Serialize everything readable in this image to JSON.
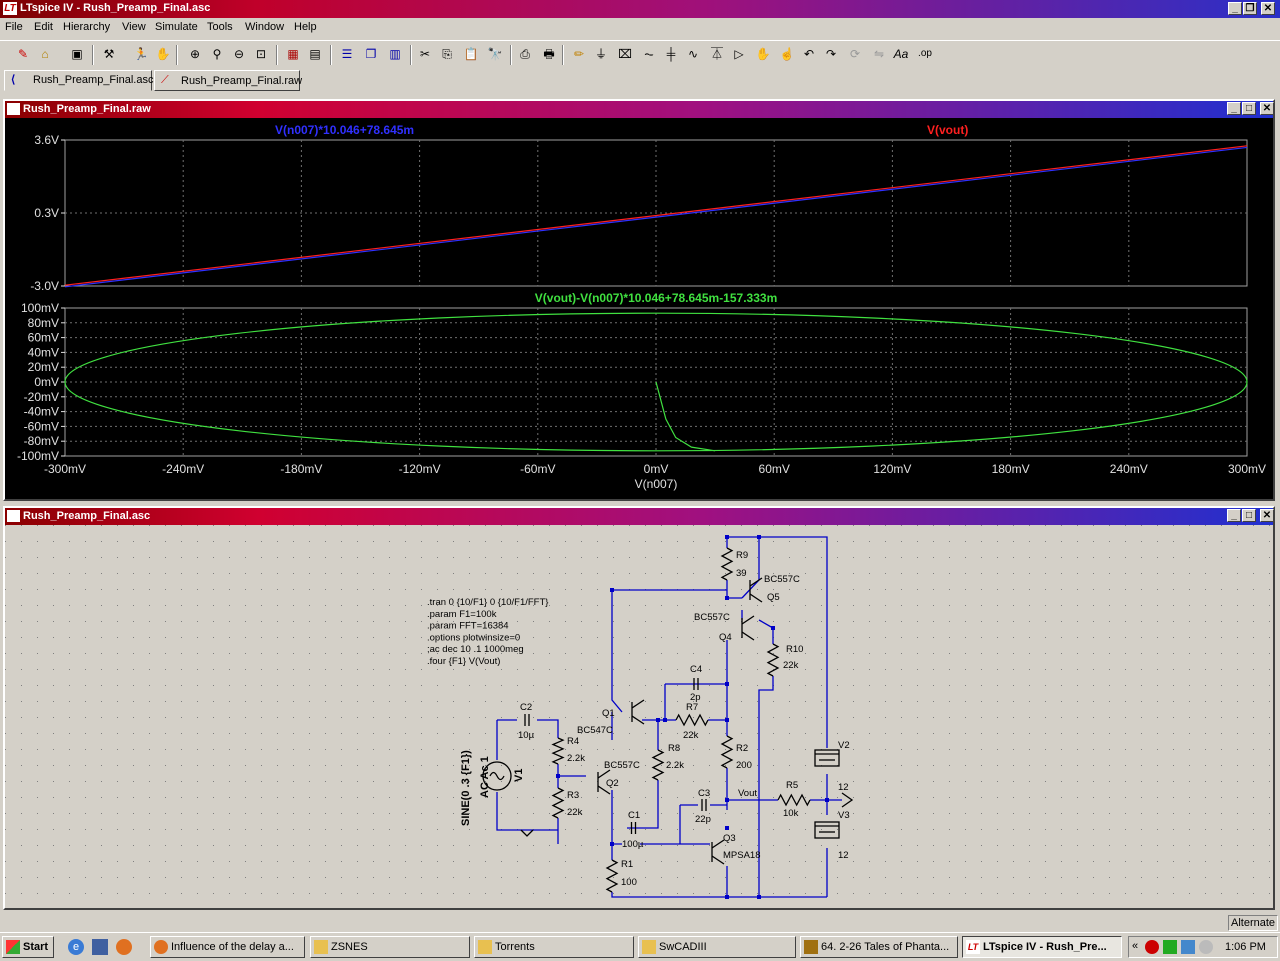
{
  "app": {
    "title": "LTspice IV - Rush_Preamp_Final.asc",
    "icon": "ltspice-icon"
  },
  "menu": [
    "File",
    "Edit",
    "Hierarchy",
    "View",
    "Simulate",
    "Tools",
    "Window",
    "Help"
  ],
  "toolbar": [
    "new-schematic-icon",
    "open-icon",
    "save-icon",
    "control-panel-icon",
    "run-icon",
    "halt-icon",
    "zoom-in-icon",
    "zoom-pan-icon",
    "zoom-out-icon",
    "zoom-fit-icon",
    "autorange-icon",
    "plot-settings-icon",
    "tile-horizontal-icon",
    "cascade-icon",
    "tile-icon",
    "cut-icon",
    "copy-icon",
    "paste-icon",
    "find-icon",
    "print-setup-icon",
    "print-icon",
    "draw-wire-icon",
    "ground-icon",
    "label-net-icon",
    "resistor-icon",
    "capacitor-icon",
    "inductor-icon",
    "diode-icon",
    "component-icon",
    "move-icon",
    "drag-icon",
    "undo-icon",
    "redo-icon",
    "rotate-icon",
    "mirror-icon",
    "text-icon",
    "spice-directive-icon"
  ],
  "tabs": [
    {
      "label": "Rush_Preamp_Final.asc",
      "icon": "schematic-icon"
    },
    {
      "label": "Rush_Preamp_Final.raw",
      "icon": "waveform-icon"
    }
  ],
  "waveform_window": {
    "title": "Rush_Preamp_Final.raw"
  },
  "schematic_window": {
    "title": "Rush_Preamp_Final.asc"
  },
  "chart_data": [
    {
      "type": "line",
      "series": [
        {
          "name": "V(n007)*10.046+78.645m",
          "color": "#3030ff",
          "x": [
            -300,
            300
          ],
          "y": [
            -3.0,
            3.3
          ]
        },
        {
          "name": "V(vout)",
          "color": "#ff2020",
          "x": [
            -300,
            300
          ],
          "y": [
            -3.0,
            3.3
          ]
        }
      ],
      "ytick_labels": [
        "3.6V",
        "0.3V",
        "-3.0V"
      ],
      "ylim": [
        -3.0,
        3.6
      ],
      "xlim": [
        -300,
        300
      ],
      "grid": true
    },
    {
      "type": "line",
      "series": [
        {
          "name": "V(vout)-V(n007)*10.046+78.645m-157.333m",
          "color": "#40e040"
        }
      ],
      "ytick_labels": [
        "100mV",
        "80mV",
        "60mV",
        "40mV",
        "20mV",
        "0mV",
        "-20mV",
        "-40mV",
        "-60mV",
        "-80mV",
        "-100mV"
      ],
      "xtick_labels": [
        "-300mV",
        "-240mV",
        "-180mV",
        "-120mV",
        "-60mV",
        "0mV",
        "60mV",
        "120mV",
        "180mV",
        "240mV",
        "300mV"
      ],
      "xlabel": "V(n007)",
      "ylim": [
        -100,
        100
      ],
      "xlim": [
        -300,
        300
      ],
      "ellipse": {
        "center_x": 0,
        "center_y": 0,
        "radius_x": 300,
        "radius_y": 93
      },
      "start_trace": {
        "x": [
          0,
          2,
          5,
          10,
          18,
          30
        ],
        "y": [
          0,
          -20,
          -50,
          -75,
          -88,
          -93
        ]
      },
      "grid": true
    }
  ],
  "schematic": {
    "directives": [
      ".tran 0 {10/F1} 0 {10/F1/FFT}",
      ".param F1=100k",
      ".param FFT=16384",
      ".options plotwinsize=0",
      ";ac dec 10 .1 1000meg",
      ".four {F1} V(Vout)"
    ],
    "components": [
      {
        "ref": "R9",
        "value": "39"
      },
      {
        "ref": "Q5",
        "value": "BC557C"
      },
      {
        "ref": "Q4",
        "value": "BC557C"
      },
      {
        "ref": "R10",
        "value": "22k"
      },
      {
        "ref": "C4",
        "value": "2p"
      },
      {
        "ref": "Q1",
        "value": "BC547C"
      },
      {
        "ref": "R7",
        "value": "22k"
      },
      {
        "ref": "R8",
        "value": "2.2k"
      },
      {
        "ref": "C2",
        "value": "10µ"
      },
      {
        "ref": "R4",
        "value": "2.2k"
      },
      {
        "ref": "Q2",
        "value": "BC557C"
      },
      {
        "ref": "R2",
        "value": "200"
      },
      {
        "ref": "V2",
        "value": "12"
      },
      {
        "ref": "R5",
        "value": "10k"
      },
      {
        "ref": "V3",
        "value": "12"
      },
      {
        "ref": "C3",
        "value": "22p"
      },
      {
        "ref": "R3",
        "value": "22k"
      },
      {
        "ref": "C1",
        "value": "100µ"
      },
      {
        "ref": "Q3",
        "value": "MPSA18"
      },
      {
        "ref": "R1",
        "value": "100"
      },
      {
        "ref": "V1",
        "value": "SINE(0 .3 {F1})",
        "extra": "AC Ac 1"
      }
    ],
    "net_label": "Vout"
  },
  "status": {
    "text": "Alternate"
  },
  "taskbar": {
    "start": "Start",
    "items": [
      {
        "label": "Influence of the delay a...",
        "icon": "firefox-icon"
      },
      {
        "label": "ZSNES",
        "icon": "folder-icon"
      },
      {
        "label": "Torrents",
        "icon": "folder-icon"
      },
      {
        "label": "SwCADIII",
        "icon": "folder-icon"
      },
      {
        "label": "64. 2-26 Tales of Phanta...",
        "icon": "winamp-icon"
      },
      {
        "label": "LTspice IV - Rush_Pre...",
        "icon": "ltspice-icon"
      }
    ],
    "clock": "1:06 PM"
  }
}
